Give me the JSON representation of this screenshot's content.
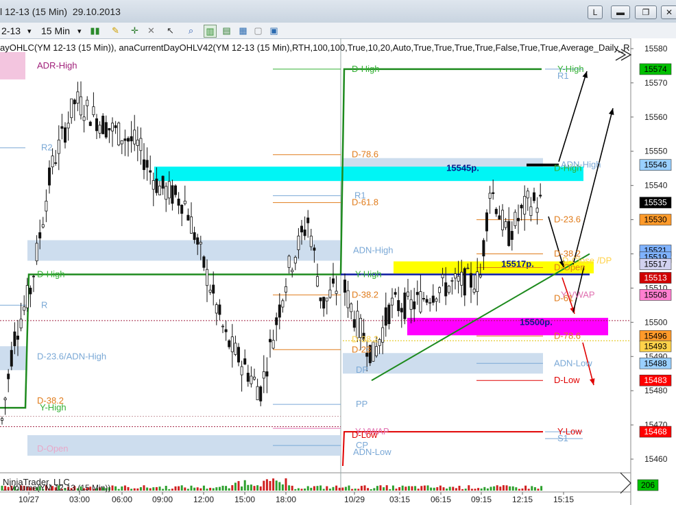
{
  "window": {
    "title": "l 12-13 (15 Min)  29.10.2013",
    "btn_l": "L",
    "btn_min": "▬",
    "btn_max": "❐",
    "btn_close": "✕"
  },
  "toolbar": {
    "instrument": "2-13",
    "interval": "15 Min",
    "dropdown": "▾"
  },
  "indicator_text": "ayOHLC(YM 12-13 (15 Min)),  anaCurrentDayOHLV42(YM 12-13 (15 Min),RTH,100,100,True,10,20,Auto,True,True,True,True,False,True,True,Average_Daily_R",
  "watermark": "NinjaTrader, LLC",
  "volume_label": "...Volume(YM 12-13 (15 Min))",
  "colors": {
    "green": "#1d8a1d",
    "cyan": "#00f5f5",
    "yellow": "#ffff00",
    "magenta": "#ff00ff",
    "zone": "#c8d9ec",
    "candle": "#111111",
    "red": "#e00000"
  },
  "chart_data": {
    "type": "candlestick",
    "instrument": "YM 12-13 (15 Min)",
    "ylim": [
      15456,
      15583
    ],
    "y_ticks": [
      15460,
      15470,
      15480,
      15490,
      15500,
      15510,
      15520,
      15530,
      15540,
      15550,
      15560,
      15570,
      15580
    ],
    "x_ticks": [
      "10/27",
      "03:00",
      "06:00",
      "09:00",
      "12:00",
      "15:00",
      "18:00",
      "10/29",
      "03:15",
      "06:15",
      "09:15",
      "12:15",
      "15:15"
    ],
    "session_break_label": "10/29",
    "price_badges": [
      {
        "value": "15574",
        "bg": "#00c000",
        "fg": "#000000"
      },
      {
        "value": "15546",
        "bg": "#9ad0ff",
        "fg": "#000000"
      },
      {
        "value": "15535",
        "bg": "#000000",
        "fg": "#ffffff"
      },
      {
        "value": "15530",
        "bg": "#ff9a2a",
        "fg": "#000000"
      },
      {
        "value": "15521",
        "bg": "#7fb2ff",
        "fg": "#000000"
      },
      {
        "value": "15519",
        "bg": "#7fb2ff",
        "fg": "#000000"
      },
      {
        "value": "15517",
        "bg": "#d2d2f0",
        "fg": "#000000"
      },
      {
        "value": "15513",
        "bg": "#d00000",
        "fg": "#ffffff"
      },
      {
        "value": "15508",
        "bg": "#ff7fd0",
        "fg": "#000000"
      },
      {
        "value": "15496",
        "bg": "#ff9a2a",
        "fg": "#000000"
      },
      {
        "value": "15493",
        "bg": "#ffd24a",
        "fg": "#000000"
      },
      {
        "value": "15488",
        "bg": "#9ad0ff",
        "fg": "#000000"
      },
      {
        "value": "15483",
        "bg": "#ff0000",
        "fg": "#ffffff"
      },
      {
        "value": "15468",
        "bg": "#ff0000",
        "fg": "#ffffff"
      }
    ],
    "volume_badge": "206",
    "zone_labels": [
      {
        "text": "15545p.",
        "price": 15545
      },
      {
        "text": "15517p.",
        "price": 15517
      },
      {
        "text": "15500p.",
        "price": 15500
      }
    ],
    "level_labels": [
      {
        "text": "ADR-High",
        "price": 15575,
        "x": 54,
        "color": "#a0207a"
      },
      {
        "text": "R2",
        "price": 15551,
        "x": 60,
        "color": "#7aa8d6"
      },
      {
        "text": "D-High",
        "price": 15514,
        "x": 54,
        "color": "#33b033"
      },
      {
        "text": "R",
        "price": 15505,
        "x": 60,
        "color": "#7aa8d6"
      },
      {
        "text": "D-23.6/ADN-High",
        "price": 15490,
        "x": 54,
        "color": "#7aa8d6"
      },
      {
        "text": "D-38.2",
        "price": 15477,
        "x": 54,
        "color": "#e07b1a"
      },
      {
        "text": "Y-High",
        "price": 15475,
        "x": 58,
        "color": "#33b033"
      },
      {
        "text": "D-Open",
        "price": 15463,
        "x": 54,
        "color": "#e8a8c8"
      },
      {
        "text": "D-High",
        "price": 15574,
        "x": 513,
        "color": "#33b033"
      },
      {
        "text": "D-78.6",
        "price": 15549,
        "x": 513,
        "color": "#e07b1a"
      },
      {
        "text": "R1",
        "price": 15537,
        "x": 517,
        "color": "#7aa8d6"
      },
      {
        "text": "D-61.8",
        "price": 15535,
        "x": 513,
        "color": "#e07b1a"
      },
      {
        "text": "ADN-High",
        "price": 15521,
        "x": 515,
        "color": "#7aa8d6"
      },
      {
        "text": "Y-High",
        "price": 15514,
        "x": 518,
        "color": "#33b033"
      },
      {
        "text": "D-38.2",
        "price": 15508,
        "x": 513,
        "color": "#e07b1a"
      },
      {
        "text": "D-38.2",
        "price": 15495,
        "x": 513,
        "color": "#ffd24a"
      },
      {
        "text": "D-23",
        "price": 15492,
        "x": 513,
        "color": "#e07b1a"
      },
      {
        "text": "DP",
        "price": 15486,
        "x": 519,
        "color": "#7aa8d6"
      },
      {
        "text": "PP",
        "price": 15476,
        "x": 519,
        "color": "#7aa8d6"
      },
      {
        "text": "Y-VWAP",
        "price": 15468,
        "x": 518,
        "color": "#e070b0"
      },
      {
        "text": "D-Low",
        "price": 15467,
        "x": 513,
        "color": "#e00000"
      },
      {
        "text": "CP",
        "price": 15464,
        "x": 519,
        "color": "#7aa8d6"
      },
      {
        "text": "ADN-Low",
        "price": 15462,
        "x": 515,
        "color": "#7aa8d6"
      },
      {
        "text": "Y-High",
        "price": 15574,
        "x": 813,
        "color": "#33b033"
      },
      {
        "text": "R1",
        "price": 15572,
        "x": 813,
        "color": "#7aa8d6"
      },
      {
        "text": "D-High",
        "price": 15545,
        "x": 808,
        "color": "#33b033"
      },
      {
        "text": "ADN-High",
        "price": 15546,
        "x": 818,
        "color": "#7aa8d6"
      },
      {
        "text": "D-23.6",
        "price": 15530,
        "x": 808,
        "color": "#e07b1a"
      },
      {
        "text": "D-38.2",
        "price": 15520,
        "x": 808,
        "color": "#e07b1a"
      },
      {
        "text": "D-Close /DP",
        "price": 15518,
        "x": 820,
        "color": "#ffd24a"
      },
      {
        "text": "D-Open",
        "price": 15516,
        "x": 808,
        "color": "#e07b1a"
      },
      {
        "text": "Y-VWAP",
        "price": 15508,
        "x": 818,
        "color": "#e070b0"
      },
      {
        "text": "D-61",
        "price": 15507,
        "x": 808,
        "color": "#e07b1a"
      },
      {
        "text": "D-78.6",
        "price": 15496,
        "x": 808,
        "color": "#e07b1a"
      },
      {
        "text": "ADN-Low",
        "price": 15488,
        "x": 808,
        "color": "#7aa8d6"
      },
      {
        "text": "D-Low",
        "price": 15483,
        "x": 808,
        "color": "#e00000"
      },
      {
        "text": "Y-Low",
        "price": 15468,
        "x": 813,
        "color": "#e00000"
      },
      {
        "text": "S1",
        "price": 15466,
        "x": 813,
        "color": "#7aa8d6"
      }
    ]
  }
}
